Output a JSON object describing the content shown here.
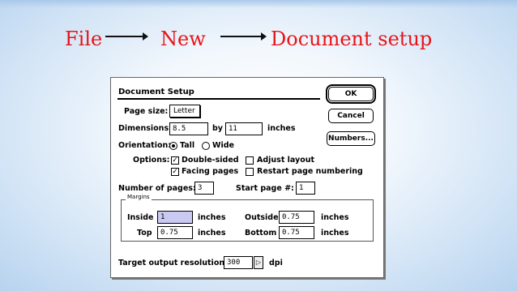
{
  "header_path": {
    "step1": "File",
    "step2": "New",
    "step3": "Document setup",
    "text_color": "#e8141a"
  },
  "dialog": {
    "title": "Document Setup",
    "buttons": {
      "ok": "OK",
      "cancel": "Cancel",
      "numbers": "Numbers..."
    },
    "page_size": {
      "label": "Page size:",
      "value": "Letter"
    },
    "dimensions": {
      "label": "Dimensions:",
      "width": "8.5",
      "by_label": "by",
      "height": "11",
      "unit": "inches"
    },
    "orientation": {
      "label": "Orientation:",
      "tall": "Tall",
      "wide": "Wide",
      "selected": "Tall"
    },
    "options": {
      "label": "Options:",
      "double_sided": {
        "label": "Double-sided",
        "checked": true
      },
      "facing_pages": {
        "label": "Facing pages",
        "checked": true
      },
      "adjust_layout": {
        "label": "Adjust layout",
        "checked": false
      },
      "restart_page_numbering": {
        "label": "Restart page numbering",
        "checked": false
      }
    },
    "number_of_pages": {
      "label": "Number of pages:",
      "value": "3"
    },
    "start_page": {
      "label": "Start page #:",
      "value": "1"
    },
    "margins": {
      "legend": "Margins",
      "inside": {
        "label": "Inside",
        "value": "1",
        "unit": "inches"
      },
      "outside": {
        "label": "Outside",
        "value": "0.75",
        "unit": "inches"
      },
      "top": {
        "label": "Top",
        "value": "0.75",
        "unit": "inches"
      },
      "bottom": {
        "label": "Bottom",
        "value": "0.75",
        "unit": "inches"
      }
    },
    "resolution": {
      "label": "Target output resolution:",
      "value": "300",
      "unit": "dpi"
    },
    "check_mark": "✓",
    "stepper_glyph": "▷"
  }
}
